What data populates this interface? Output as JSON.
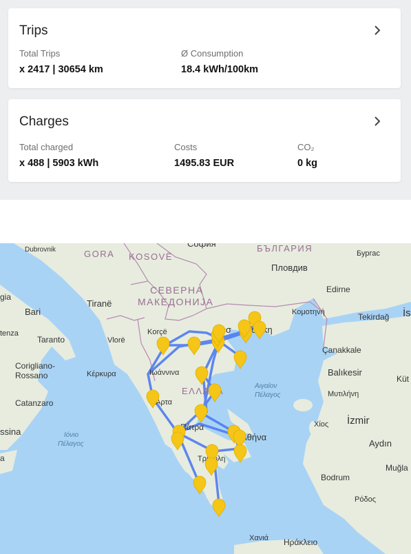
{
  "trips": {
    "title": "Trips",
    "total_label": "Total Trips",
    "total_value": "x 2417 | 30654 km",
    "consumption_label": "Ø Consumption",
    "consumption_value": "18.4 kWh/100km"
  },
  "charges": {
    "title": "Charges",
    "total_label": "Total charged",
    "total_value": "x 488 | 5903 kWh",
    "costs_label": "Costs",
    "costs_value": "1495.83 EUR",
    "co2_label": "CO₂",
    "co2_value": "0 kg"
  },
  "map": {
    "colors": {
      "sea": "#a9d3f5",
      "land": "#e7ecdf",
      "route": "#4f7cf0",
      "marker": "#f5c518"
    },
    "labels": {
      "sofia": "София",
      "bulgaria": "БЪЛГАРИЯ",
      "dubrovnik": "Dubrovnik",
      "gora": "GORA",
      "kosove": "KOSOVË",
      "plovdiv": "Пловдив",
      "burgas": "Бургас",
      "severna": "СЕВЕРНА",
      "makedonija": "МАКЕДОНИЈА",
      "tirane": "Tiranë",
      "gia": "gia",
      "bari": "Bari",
      "edirne": "Edirne",
      "komotini": "Κομοτηνή",
      "tekirdag": "Tekirdağ",
      "istanbul": "İs",
      "tenza": "tenza",
      "taranto": "Taranto",
      "korce": "Korçë",
      "vlore": "Vlorë",
      "thessaloniki_a": "Θεσ",
      "thessaloniki_b": "λονίκη",
      "canakkale": "Çanakkale",
      "corigliano": "Corigliano-",
      "rossano": "Rossano",
      "kerkyra": "Κέρκυρα",
      "ioannina": "Ιωάννινα",
      "balikesir": "Balıkesir",
      "kut": "Küt",
      "ellada": "ΕΛΛΑΔΑ",
      "aigaio_a": "Αιγαίον",
      "aigaio_b": "Πέλαγος",
      "mytilini": "Μυτιλήνη",
      "catanzaro": "Catanzaro",
      "arta": "Άρτα",
      "ssina": "ssina",
      "ionio_a": "Ιόνιο",
      "ionio_b": "Πέλαγος",
      "patra": "Πάτρα",
      "athina": "Αθήνα",
      "chios": "Χίος",
      "izmir": "İzmir",
      "aydin": "Aydın",
      "tripoli": "Τρίπολη",
      "mugla": "Muğla",
      "bodrum": "Bodrum",
      "rodos": "Ρόδος",
      "chania": "Χανιά",
      "irakleio": "Ηράκλειο",
      "edge_a": "a"
    }
  }
}
